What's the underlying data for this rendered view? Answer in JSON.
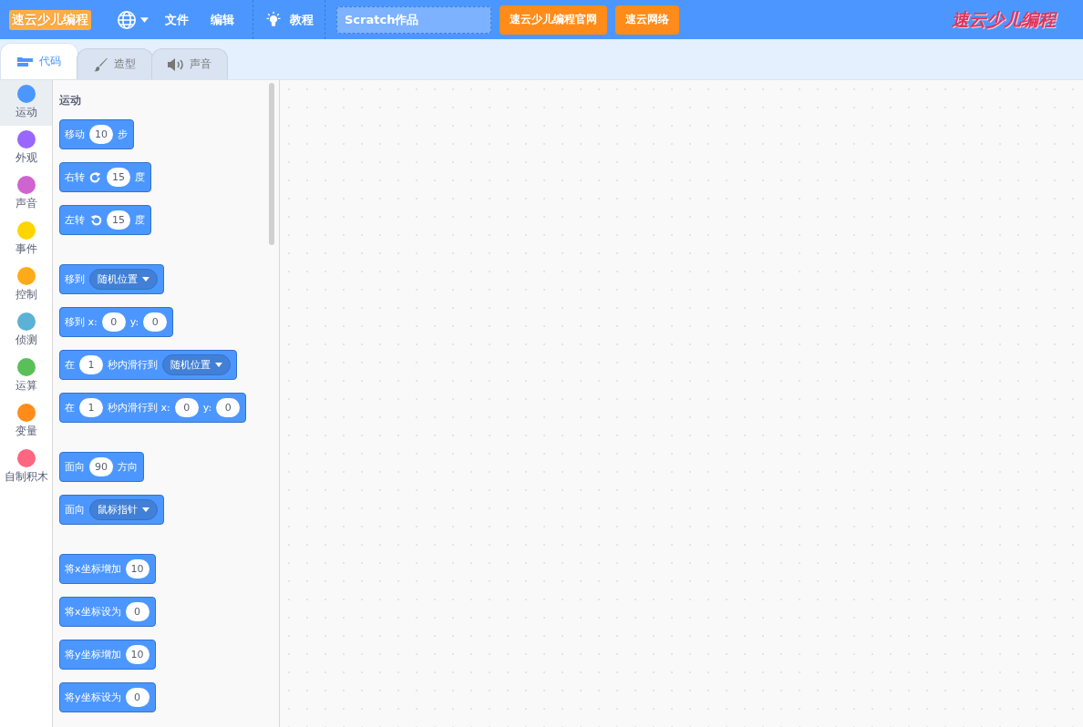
{
  "menu_bar": {
    "logo": "速云少儿编程",
    "items": [
      {
        "kind": "language"
      },
      {
        "kind": "text",
        "label": "文件"
      },
      {
        "kind": "text",
        "label": "编辑"
      },
      {
        "kind": "tutorial",
        "label": "教程"
      }
    ],
    "project_title": {
      "value": "Scratch作品"
    },
    "buttons": [
      "速云少儿编程官网",
      "速云网络"
    ],
    "brand_logo": "速云少儿编程"
  },
  "tabs": [
    {
      "label": "代码",
      "kind": "code",
      "selected": true
    },
    {
      "label": "造型",
      "kind": "costume",
      "selected": false
    },
    {
      "label": "声音",
      "kind": "sound",
      "selected": false
    }
  ],
  "categories": [
    {
      "label": "运动",
      "color": "#4c97ff",
      "selected": true
    },
    {
      "label": "外观",
      "color": "#9966ff",
      "selected": false
    },
    {
      "label": "声音",
      "color": "#cf63cf",
      "selected": false
    },
    {
      "label": "事件",
      "color": "#ffd500",
      "selected": false
    },
    {
      "label": "控制",
      "color": "#ffab19",
      "selected": false
    },
    {
      "label": "侦测",
      "color": "#5cb1d6",
      "selected": false
    },
    {
      "label": "运算",
      "color": "#59c059",
      "selected": false
    },
    {
      "label": "变量",
      "color": "#ff8c1a",
      "selected": false
    },
    {
      "label": "自制积木",
      "color": "#ff6680",
      "selected": false
    }
  ],
  "palette": {
    "heading": "运动",
    "groups": [
      [
        {
          "parts": [
            {
              "kind": "text",
              "text": "移动"
            },
            {
              "kind": "input",
              "text": "10"
            },
            {
              "kind": "text",
              "text": "步"
            }
          ]
        },
        {
          "parts": [
            {
              "kind": "text",
              "text": "右转"
            },
            {
              "kind": "rotate-right"
            },
            {
              "kind": "input",
              "text": "15"
            },
            {
              "kind": "text",
              "text": "度"
            }
          ]
        },
        {
          "parts": [
            {
              "kind": "text",
              "text": "左转"
            },
            {
              "kind": "rotate-left"
            },
            {
              "kind": "input",
              "text": "15"
            },
            {
              "kind": "text",
              "text": "度"
            }
          ]
        }
      ],
      [
        {
          "parts": [
            {
              "kind": "text",
              "text": "移到"
            },
            {
              "kind": "dropdown",
              "text": "随机位置"
            }
          ]
        },
        {
          "parts": [
            {
              "kind": "text",
              "text": "移到 x:"
            },
            {
              "kind": "input",
              "text": "0"
            },
            {
              "kind": "text",
              "text": "y:"
            },
            {
              "kind": "input",
              "text": "0"
            }
          ]
        },
        {
          "parts": [
            {
              "kind": "text",
              "text": "在"
            },
            {
              "kind": "input",
              "text": "1"
            },
            {
              "kind": "text",
              "text": "秒内滑行到"
            },
            {
              "kind": "dropdown",
              "text": "随机位置"
            }
          ]
        },
        {
          "parts": [
            {
              "kind": "text",
              "text": "在"
            },
            {
              "kind": "input",
              "text": "1"
            },
            {
              "kind": "text",
              "text": "秒内滑行到 x:"
            },
            {
              "kind": "input",
              "text": "0"
            },
            {
              "kind": "text",
              "text": "y:"
            },
            {
              "kind": "input",
              "text": "0"
            }
          ]
        }
      ],
      [
        {
          "parts": [
            {
              "kind": "text",
              "text": "面向"
            },
            {
              "kind": "input",
              "text": "90"
            },
            {
              "kind": "text",
              "text": "方向"
            }
          ]
        },
        {
          "parts": [
            {
              "kind": "text",
              "text": "面向"
            },
            {
              "kind": "dropdown",
              "text": "鼠标指针"
            }
          ]
        }
      ],
      [
        {
          "parts": [
            {
              "kind": "text",
              "text": "将x坐标增加"
            },
            {
              "kind": "input",
              "text": "10"
            }
          ]
        },
        {
          "parts": [
            {
              "kind": "text",
              "text": "将x坐标设为"
            },
            {
              "kind": "input",
              "text": "0"
            }
          ]
        },
        {
          "parts": [
            {
              "kind": "text",
              "text": "将y坐标增加"
            },
            {
              "kind": "input",
              "text": "10"
            }
          ]
        },
        {
          "parts": [
            {
              "kind": "text",
              "text": "将y坐标设为"
            },
            {
              "kind": "input",
              "text": "0"
            }
          ]
        }
      ]
    ]
  }
}
